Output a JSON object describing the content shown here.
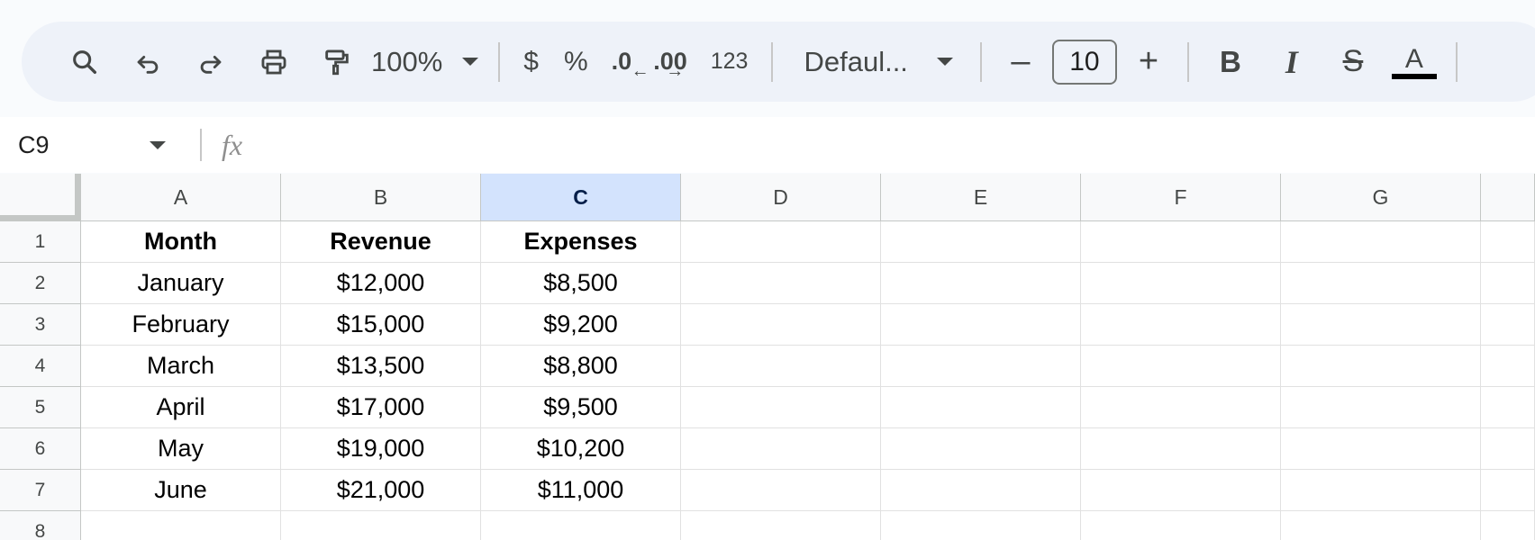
{
  "toolbar": {
    "zoom": "100%",
    "currency_label": "$",
    "percent_label": "%",
    "decrease_decimal_label": ".0",
    "increase_decimal_label": ".00",
    "number_format_label": "123",
    "font_name": "Defaul...",
    "font_size": "10",
    "minus_label": "–",
    "plus_label": "+",
    "bold_label": "B",
    "italic_label": "I",
    "strike_label": "S",
    "text_color_label": "A",
    "text_color": "#000000"
  },
  "formula_bar": {
    "namebox": "C9",
    "fx_label": "fx",
    "content": ""
  },
  "grid": {
    "columns": [
      "A",
      "B",
      "C",
      "D",
      "E",
      "F",
      "G"
    ],
    "selected_column": "C",
    "rows": [
      "1",
      "2",
      "3",
      "4",
      "5",
      "6",
      "7",
      "8"
    ],
    "cells": [
      [
        "Month",
        "Revenue",
        "Expenses",
        "",
        "",
        "",
        ""
      ],
      [
        "January",
        "$12,000",
        "$8,500",
        "",
        "",
        "",
        ""
      ],
      [
        "February",
        "$15,000",
        "$9,200",
        "",
        "",
        "",
        ""
      ],
      [
        "March",
        "$13,500",
        "$8,800",
        "",
        "",
        "",
        ""
      ],
      [
        "April",
        "$17,000",
        "$9,500",
        "",
        "",
        "",
        ""
      ],
      [
        "May",
        "$19,000",
        "$10,200",
        "",
        "",
        "",
        ""
      ],
      [
        "June",
        "$21,000",
        "$11,000",
        "",
        "",
        "",
        ""
      ],
      [
        "",
        "",
        "",
        "",
        "",
        "",
        ""
      ]
    ]
  },
  "colors": {
    "toolbar_bg": "#eef2f9",
    "selected_header_bg": "#d3e3fd",
    "grid_line": "#e1e1e1"
  }
}
